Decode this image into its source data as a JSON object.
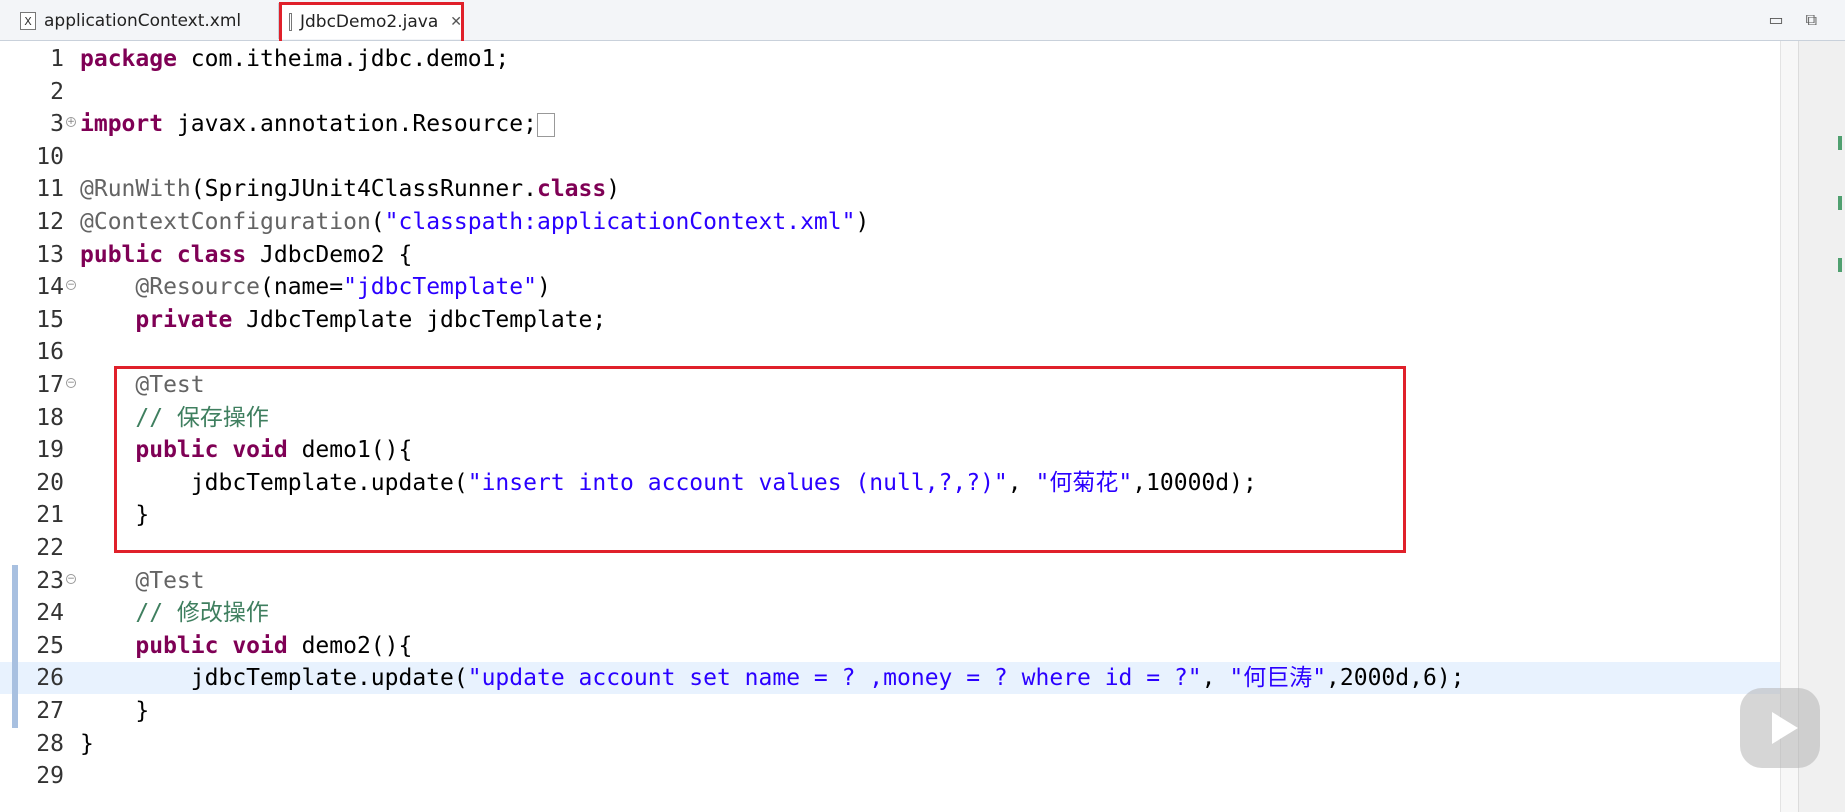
{
  "tabs": [
    {
      "label": "applicationContext.xml",
      "icon": "xml-file-icon"
    },
    {
      "label": "JdbcDemo2.java",
      "icon": "java-file-icon",
      "active": true
    }
  ],
  "window_buttons": [
    "minimize-icon",
    "maximize-icon"
  ],
  "lines": [
    {
      "n": "1",
      "html": "<span class=\"kw\">package</span> com.itheima.jdbc.demo1;"
    },
    {
      "n": "2",
      "html": ""
    },
    {
      "n": "3",
      "fold": "+",
      "html": "<span class=\"kw\">import</span> javax.annotation.Resource;<span style=\"display:inline-block;width:16px;height:22px;border:1px solid #999;vertical-align:middle;\"></span>"
    },
    {
      "n": "10",
      "html": ""
    },
    {
      "n": "11",
      "html": "<span class=\"ann\">@RunWith</span>(SpringJUnit4ClassRunner.<span class=\"kw\">class</span>)"
    },
    {
      "n": "12",
      "html": "<span class=\"ann\">@ContextConfiguration</span>(<span class=\"str\">\"classpath:applicationContext.xml\"</span>)"
    },
    {
      "n": "13",
      "html": "<span class=\"kw\">public class</span> JdbcDemo2 {"
    },
    {
      "n": "14",
      "fold": "-",
      "html": "    <span class=\"ann\">@Resource</span>(name=<span class=\"str\">\"jdbcTemplate\"</span>)"
    },
    {
      "n": "15",
      "html": "    <span class=\"kw\">private</span> JdbcTemplate jdbcTemplate;"
    },
    {
      "n": "16",
      "html": ""
    },
    {
      "n": "17",
      "fold": "-",
      "html": "    <span class=\"ann\">@Test</span>"
    },
    {
      "n": "18",
      "html": "    <span class=\"cmt\">// 保存操作</span>"
    },
    {
      "n": "19",
      "html": "    <span class=\"kw\">public void</span> demo1(){"
    },
    {
      "n": "20",
      "html": "        jdbcTemplate.update(<span class=\"str\">\"insert into account values (null,?,?)\"</span>, <span class=\"str\">\"何菊花\"</span>,10000d);"
    },
    {
      "n": "21",
      "html": "    }"
    },
    {
      "n": "22",
      "html": ""
    },
    {
      "n": "23",
      "fold": "-",
      "marker": true,
      "html": "    <span class=\"ann\">@Test</span>"
    },
    {
      "n": "24",
      "marker": true,
      "html": "    <span class=\"cmt\">// 修改操作</span>"
    },
    {
      "n": "25",
      "marker": true,
      "html": "    <span class=\"kw\">public void</span> demo2(){"
    },
    {
      "n": "26",
      "marker": true,
      "current": true,
      "html": "        jdbcTemplate.update(<span class=\"str\">\"update account set name = ? ,money = ? where id = ?\"</span>, <span class=\"str\">\"何巨涛\"</span>,2000d,6);"
    },
    {
      "n": "27",
      "marker": true,
      "html": "    }"
    },
    {
      "n": "28",
      "html": "}"
    },
    {
      "n": "29",
      "html": ""
    }
  ]
}
